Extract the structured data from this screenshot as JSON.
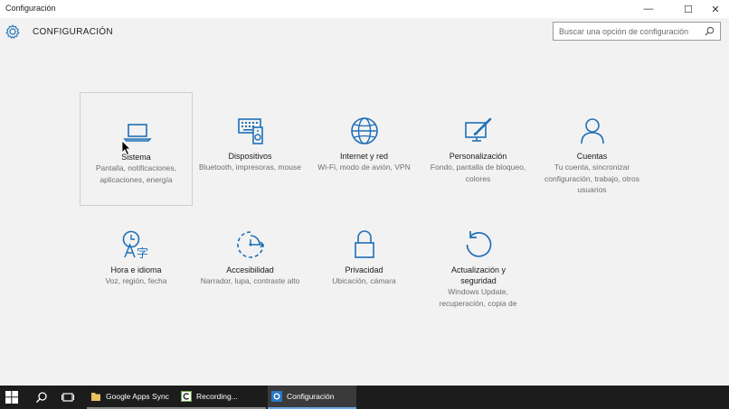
{
  "window": {
    "title": "Configuración",
    "minimize": "—",
    "maximize": "☐",
    "close": "✕"
  },
  "header": {
    "title": "CONFIGURACIÓN",
    "icon": "gear-icon",
    "search_placeholder": "Buscar una opción de configuración"
  },
  "tiles": [
    {
      "name": "Sistema",
      "desc": "Pantalla, notificaciones, aplicaciones, energía",
      "icon": "laptop-icon"
    },
    {
      "name": "Dispositivos",
      "desc": "Bluetooth, impresoras, mouse",
      "icon": "devices-icon"
    },
    {
      "name": "Internet y red",
      "desc": "Wi-Fi, modo de avión, VPN",
      "icon": "globe-icon"
    },
    {
      "name": "Personalización",
      "desc": "Fondo, pantalla de bloqueo, colores",
      "icon": "paint-icon"
    },
    {
      "name": "Cuentas",
      "desc": "Tu cuenta, sincronizar configuración, trabajo, otros usuarios",
      "icon": "person-icon"
    },
    {
      "name": "Hora e idioma",
      "desc": "Voz, región, fecha",
      "icon": "time-language-icon"
    },
    {
      "name": "Accesibilidad",
      "desc": "Narrador, lupa, contraste alto",
      "icon": "accessibility-icon"
    },
    {
      "name": "Privacidad",
      "desc": "Ubicación, cámara",
      "icon": "lock-icon"
    },
    {
      "name": "Actualización y seguridad",
      "desc": "Windows Update, recuperación, copia de",
      "icon": "update-icon"
    }
  ],
  "taskbar": {
    "apps": [
      {
        "label": "Google Apps Sync",
        "icon": "folder-icon"
      },
      {
        "label": "Recording...",
        "icon": "recorder-icon"
      },
      {
        "label": "Configuración",
        "icon": "gear-icon"
      }
    ]
  },
  "colors": {
    "accent": "#1e6fb8",
    "background": "#f2f2f2",
    "taskbar": "#1c1c1c"
  }
}
